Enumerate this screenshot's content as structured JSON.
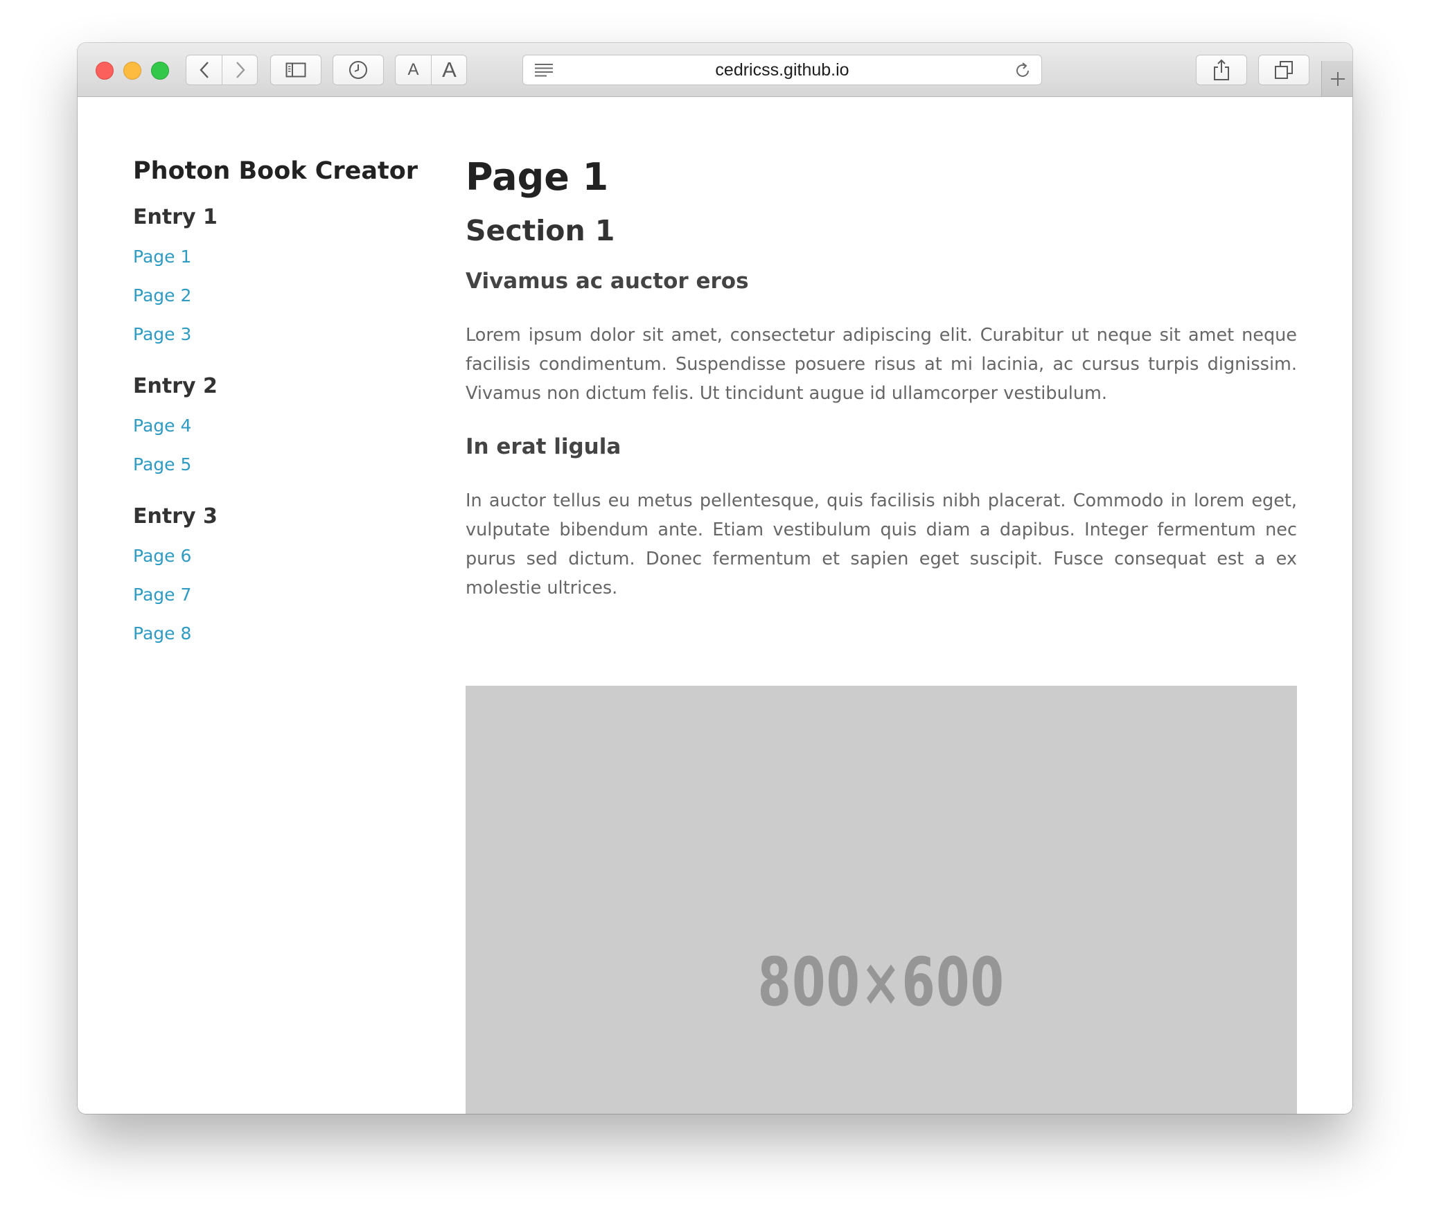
{
  "browser": {
    "url": "cedricss.github.io",
    "icons": {
      "back": "chevron-left-icon",
      "forward": "chevron-right-icon",
      "sidebar": "sidebar-icon",
      "history": "clock-icon",
      "reader": "reader-lines-icon",
      "reload": "reload-icon",
      "share": "share-icon",
      "tabs": "tabs-icon",
      "new_tab": "plus-icon"
    },
    "text_size_small": "A",
    "text_size_large": "A"
  },
  "sidebar": {
    "title": "Photon Book Creator",
    "entries": [
      {
        "title": "Entry 1",
        "pages": [
          "Page 1",
          "Page 2",
          "Page 3"
        ]
      },
      {
        "title": "Entry 2",
        "pages": [
          "Page 4",
          "Page 5"
        ]
      },
      {
        "title": "Entry 3",
        "pages": [
          "Page 6",
          "Page 7",
          "Page 8"
        ]
      }
    ]
  },
  "main": {
    "page_title": "Page 1",
    "section_title": "Section 1",
    "subsections": [
      {
        "title": "Vivamus ac auctor eros",
        "text": "Lorem ipsum dolor sit amet, consectetur adipiscing elit. Curabitur ut neque sit amet neque facilisis condimentum. Suspendisse posuere risus at mi lacinia, ac cursus turpis dignissim. Vivamus non dictum felis. Ut tincidunt augue id ullamcorper vestibulum."
      },
      {
        "title": "In erat ligula",
        "text": "In auctor tellus eu metus pellentesque, quis facilisis nibh placerat. Commodo in lorem eget, vulputate bibendum ante. Etiam vestibulum quis diam a dapibus. Integer fermentum nec purus sed dictum. Donec fermentum et sapien eget suscipit. Fusce consequat est a ex molestie ultrices."
      }
    ],
    "image_placeholder_label": "800×600"
  },
  "colors": {
    "link": "#2f9ac2",
    "placeholder_bg": "#cccccc",
    "placeholder_text": "#969696"
  }
}
